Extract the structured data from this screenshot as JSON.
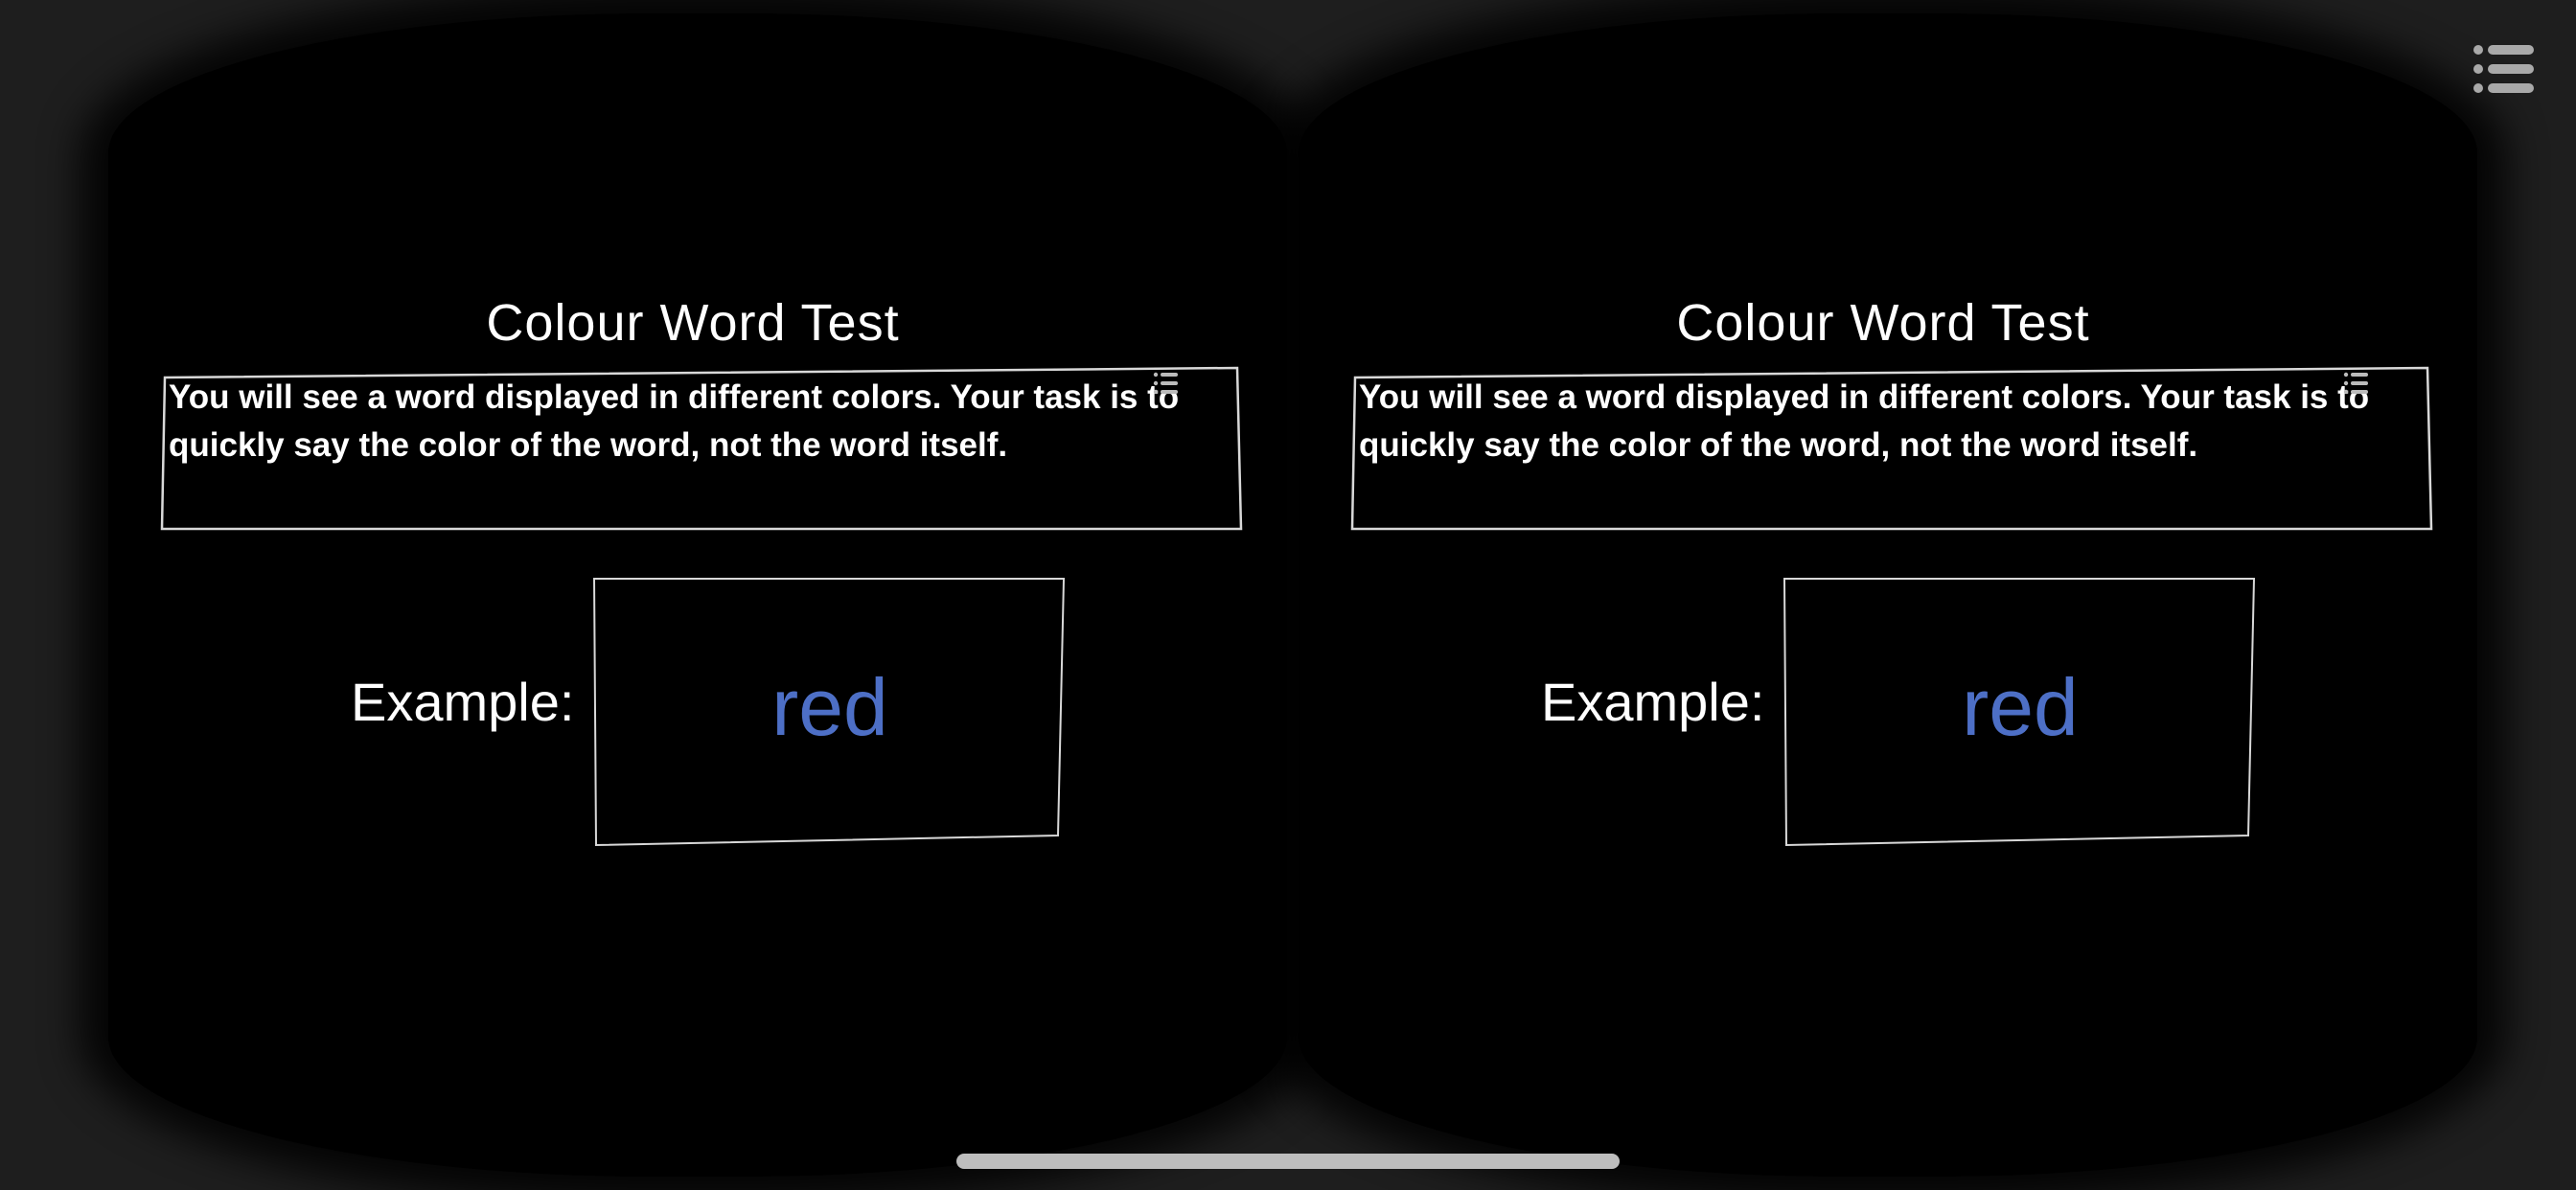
{
  "viewer": {
    "mode": "stereo-vr",
    "menu_icon": "list-icon",
    "colors": {
      "background": "#000000",
      "text": "#ffffff",
      "example_word": "#4d6fc6",
      "frame": "#d8d8d8"
    }
  },
  "screen": {
    "title": "Colour Word Test",
    "instruction": "You will see a word displayed in different colors. Your task is to quickly say the color of the word, not the word itself.",
    "example_label": "Example:",
    "example_word": "red"
  }
}
